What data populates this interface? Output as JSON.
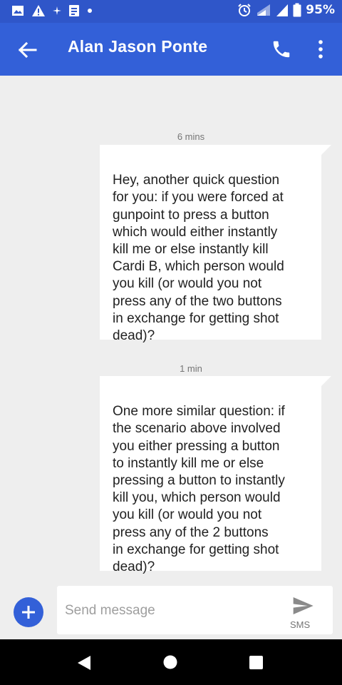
{
  "status_bar": {
    "battery_percent": "95%"
  },
  "header": {
    "contact_name": "Alan Jason Ponte"
  },
  "messages": [
    {
      "timestamp": "6 mins",
      "text": "Hey, another quick question\nfor you: if you were forced at\ngunpoint to press a button\nwhich would either instantly\nkill me or else instantly kill\nCardi B, which person would\nyou kill (or would you not\npress any of the two buttons\nin exchange for getting shot\ndead)?"
    },
    {
      "timestamp": "1 min",
      "text": "One more similar question: if\nthe scenario above involved\nyou either pressing a button\nto instantly kill me or else\npressing a button to instantly\nkill you, which person would\nyou kill (or would you not\npress any of the 2 buttons\nin exchange for getting shot\ndead)?"
    }
  ],
  "compose": {
    "placeholder": "Send message",
    "send_type_label": "SMS"
  },
  "colors": {
    "app_bar": "#3360d8",
    "status_bar": "#2f56c9",
    "background": "#eeeeee",
    "bubble": "#ffffff"
  }
}
